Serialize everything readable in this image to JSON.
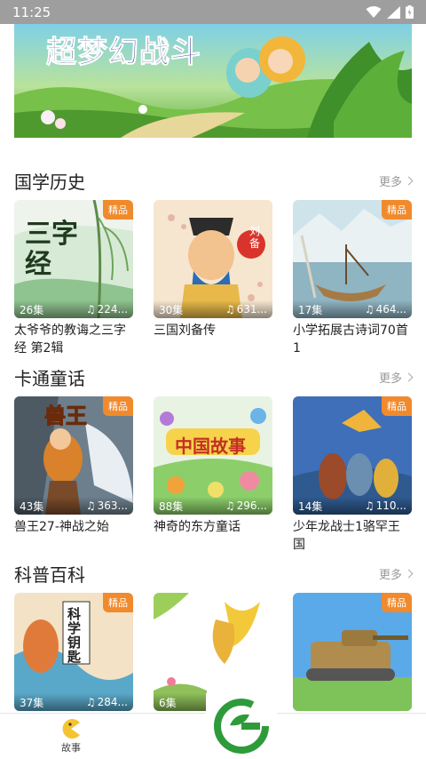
{
  "status_bar": {
    "time": "11:25"
  },
  "banner": {
    "title": "超梦幻战斗"
  },
  "sections": [
    {
      "title": "国学历史",
      "more": "更多",
      "cards": [
        {
          "badge": "精品",
          "episodes": "26集",
          "plays": "224...",
          "title": "太爷爷的教诲之三字经 第2辑",
          "cover_text": "三字经"
        },
        {
          "badge": "",
          "episodes": "30集",
          "plays": "631...",
          "title": "三国刘备传",
          "cover_text": "刘备"
        },
        {
          "badge": "精品",
          "episodes": "17集",
          "plays": "464...",
          "title": "小学拓展古诗词70首 1",
          "cover_text": ""
        }
      ]
    },
    {
      "title": "卡通童话",
      "more": "更多",
      "cards": [
        {
          "badge": "精品",
          "episodes": "43集",
          "plays": "363...",
          "title": "兽王27-神战之始",
          "cover_text": "兽王"
        },
        {
          "badge": "",
          "episodes": "88集",
          "plays": "296...",
          "title": "神奇的东方童话",
          "cover_text": "中国故事"
        },
        {
          "badge": "精品",
          "episodes": "14集",
          "plays": "110...",
          "title": "少年龙战士1骆罕王国",
          "cover_text": ""
        }
      ]
    },
    {
      "title": "科普百科",
      "more": "更多",
      "cards": [
        {
          "badge": "精品",
          "episodes": "37集",
          "plays": "284...",
          "title": "",
          "cover_text": "科学钥匙"
        },
        {
          "badge": "",
          "episodes": "6集",
          "plays": "",
          "title": "",
          "cover_text": ""
        },
        {
          "badge": "精品",
          "episodes": "",
          "plays": "",
          "title": "",
          "cover_text": ""
        }
      ]
    }
  ],
  "tab_bar": {
    "tabs": [
      {
        "label": "故事",
        "icon": "pacman-icon"
      }
    ]
  },
  "colors": {
    "badge": "#f08a2c",
    "status_bar": "#9e9e9e",
    "logo_green": "#2e9b3a"
  }
}
